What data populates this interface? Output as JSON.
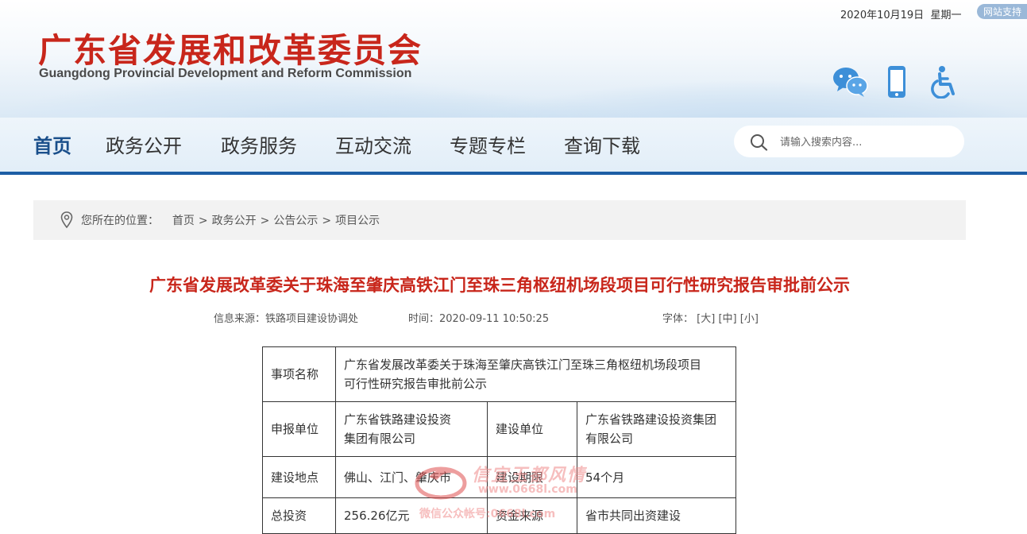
{
  "header": {
    "title_cn": "广东省发展和改革委员会",
    "title_en": "Guangdong Provincial Development and Reform Commission",
    "date": "2020年10月19日",
    "weekday": "星期一",
    "support_badge": "网站支持",
    "icons": [
      "wechat-icon",
      "mobile-icon",
      "accessibility-icon"
    ]
  },
  "nav": {
    "items": [
      {
        "label": "首页",
        "active": true
      },
      {
        "label": "政务公开",
        "active": false
      },
      {
        "label": "政务服务",
        "active": false
      },
      {
        "label": "互动交流",
        "active": false
      },
      {
        "label": "专题专栏",
        "active": false
      },
      {
        "label": "查询下载",
        "active": false
      }
    ],
    "search_placeholder": "请输入搜索内容..."
  },
  "breadcrumb": {
    "prefix": "您所在的位置：",
    "items": [
      "首页",
      "政务公开",
      "公告公示",
      "项目公示"
    ],
    "separator": ">"
  },
  "article": {
    "title": "广东省发展改革委关于珠海至肇庆高铁江门至珠三角枢纽机场段项目可行性研究报告审批前公示",
    "source_label": "信息来源：",
    "source": "铁路项目建设协调处",
    "time_label": "时间：",
    "time": "2020-09-11 10:50:25",
    "font_label": "字体：",
    "font_sizes": [
      "[大]",
      "[中]",
      "[小]"
    ]
  },
  "table": {
    "item_name_label": "事项名称",
    "item_name_line1": "广东省发展改革委关于珠海至肇庆高铁江门至珠三角枢纽机场段项目",
    "item_name_line2": "可行性研究报告审批前公示",
    "applicant_label": "申报单位",
    "applicant_line1": "广东省铁路建设投资",
    "applicant_line2": "集团有限公司",
    "builder_label": "建设单位",
    "builder_line1": "广东省铁路建设投资集团",
    "builder_line2": "有限公司",
    "location_label": "建设地点",
    "location": "佛山、江门、肇庆市",
    "period_label": "建设期限",
    "period": "54个月",
    "investment_label": "总投资",
    "investment": "256.26亿元",
    "funding_label": "资金来源",
    "funding": "省市共同出资建设"
  },
  "watermark": {
    "line1": "信宜玉都风情",
    "line2": "www.0668l.com",
    "line3": "微信公众帐号:0668l.com"
  },
  "colors": {
    "brand_red": "#c8261b",
    "nav_blue": "#1d5ea5",
    "active_nav": "#1a4f8b",
    "icon_blue": "#3d8fd8"
  }
}
